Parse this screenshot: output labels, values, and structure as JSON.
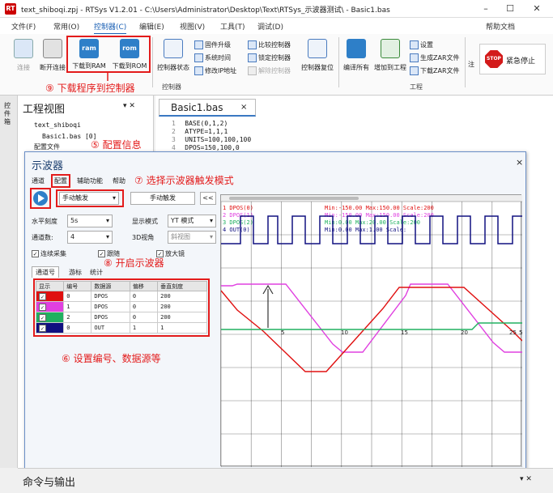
{
  "window": {
    "title": "text_shiboqi.zpj - RTSys V1.2.01 - C:\\Users\\Administrator\\Desktop\\Text\\RTSys_示波器测试\\ - Basic1.bas",
    "app_icon": "RT",
    "minimize": "–",
    "maximize": "☐",
    "close": "✕",
    "help": "帮助文档"
  },
  "menu": [
    "文件(F)",
    "常用(O)",
    "控制器(C)",
    "编辑(E)",
    "视图(V)",
    "工具(T)",
    "调试(D)"
  ],
  "ribbon": {
    "connect": "连接",
    "disconnect": "断开连接",
    "download_ram": "下载到RAM",
    "download_rom": "下载到ROM",
    "ram_icon": "ram",
    "rom_icon": "rom",
    "controller_status": "控制器状态",
    "firmware_upgrade": "固件升级",
    "system_time": "系统时间",
    "modify_ip": "修改IP地址",
    "compare_controller": "比较控制器",
    "lock_controller": "锁定控制器",
    "unlock_controller": "解除控制器",
    "controller_reset": "控制器复位",
    "group_controller": "控制器",
    "compile_all": "编译所有",
    "add_to_project": "增加到工程",
    "settings": "设置",
    "generate_zar": "生成ZAR文件",
    "download_zar": "下载ZAR文件",
    "group_project": "工程",
    "cut_short": "注",
    "emergency_stop": "紧急停止",
    "stop_icon": "STOP"
  },
  "annotations": {
    "a9": "⑨ 下载程序到控制器",
    "a5": "⑤ 配置信息",
    "a7": "⑦ 选择示波器触发模式",
    "a8": "⑧ 开启示波器",
    "a6": "⑥ 设置编号、数据源等"
  },
  "left_panel": {
    "strip_label": "控件箱",
    "title": "工程视图",
    "tree": [
      "text_shiboqi",
      "Basic1.bas [0]",
      "配置文件"
    ]
  },
  "editor": {
    "tab": "Basic1.bas",
    "lines": [
      {
        "no": "1",
        "text": "BASE(0,1,2)"
      },
      {
        "no": "2",
        "text": "ATYPE=1,1,1"
      },
      {
        "no": "3",
        "text": "UNITS=100,100,100"
      },
      {
        "no": "4",
        "text": "DPOS=150,100,0"
      }
    ]
  },
  "oscilloscope": {
    "title": "示波器",
    "close": "×",
    "menu": [
      "通道",
      "配置",
      "辅助功能",
      "帮助"
    ],
    "trigger_mode": "手动触发",
    "manual_trigger_btn": "手动触发",
    "collapse_btn": "<<",
    "horizontal_scale_label": "水平刻度",
    "horizontal_scale": "5s",
    "display_mode_label": "显示模式",
    "display_mode": "YT 模式",
    "channel_count_label": "通道数:",
    "channel_count": "4",
    "view_3d_label": "3D视角",
    "view_3d": "斜视图",
    "continuous": "连续采集",
    "follow": "跟随",
    "magnifier": "放大镜",
    "tabs": [
      "通道号",
      "游标",
      "统计"
    ],
    "table_headers": [
      "显示",
      "编号",
      "数据源",
      "偏移",
      "垂直刻度"
    ],
    "channels": [
      {
        "color": "#e01010",
        "num": "0",
        "source": "DPOS",
        "offset": "0",
        "scale": "200"
      },
      {
        "color": "#e040e0",
        "num": "1",
        "source": "DPOS",
        "offset": "0",
        "scale": "200"
      },
      {
        "color": "#20b060",
        "num": "2",
        "source": "DPOS",
        "offset": "0",
        "scale": "200"
      },
      {
        "color": "#101080",
        "num": "0",
        "source": "OUT",
        "offset": "1",
        "scale": "1"
      }
    ],
    "legend": [
      {
        "name": "1 DPOS(0)",
        "info": "Min:-150.00  Max:150.00  Scale:200",
        "color": "#e01010"
      },
      {
        "name": "2 DPOS(1)",
        "info": "Min:-150.00  Max:150.00  Scale:200",
        "color": "#e040e0"
      },
      {
        "name": "3 DPOS(2)",
        "info": "Min:0.00  Max:20.00  Scale:200",
        "color": "#20b060"
      },
      {
        "name": "4 OUT(0)",
        "info": "Min:0.00  Max:1.00  Scale:",
        "color": "#101080"
      }
    ],
    "x_ticks": [
      "5",
      "10",
      "15",
      "20",
      "25",
      "5"
    ]
  },
  "output_panel": {
    "title": "命令与输出"
  }
}
